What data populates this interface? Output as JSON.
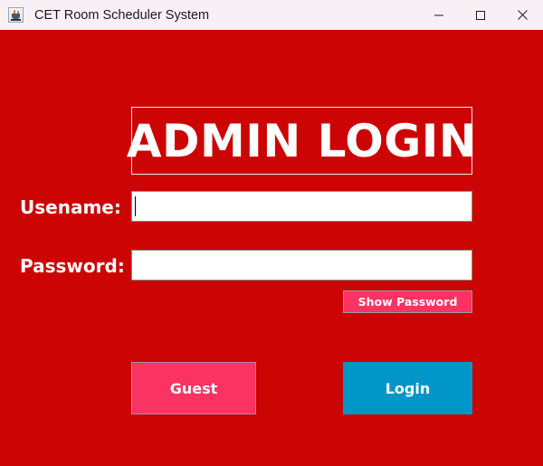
{
  "window": {
    "title": "CET Room Scheduler System",
    "app_icon": "java-coffee-cup-icon",
    "controls": {
      "minimize": "minimize-icon",
      "maximize": "maximize-icon",
      "close": "close-icon"
    },
    "colors": {
      "titlebar_background": "#F9F0F5",
      "content_background": "#CC0404",
      "accent_pink": "#FA3362",
      "accent_blue": "#0096C8",
      "text_on_accent": "#FFFFFF"
    }
  },
  "panel": {
    "heading": "ADMIN LOGIN"
  },
  "form": {
    "username": {
      "label": "Usename:",
      "value": "",
      "placeholder": "",
      "focused": true
    },
    "password": {
      "label": "Password:",
      "value": "",
      "placeholder": "",
      "focused": false
    },
    "show_password_label": "Show Password"
  },
  "actions": {
    "guest_label": "Guest",
    "login_label": "Login"
  }
}
